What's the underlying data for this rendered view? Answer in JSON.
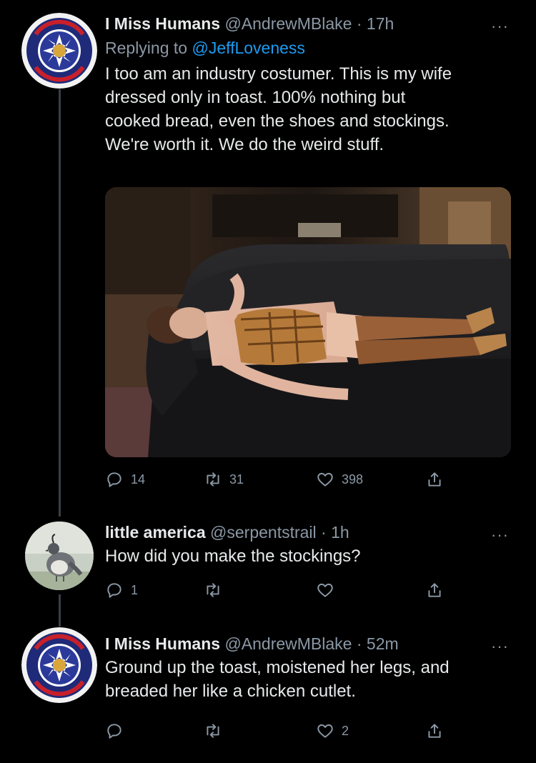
{
  "tweets": [
    {
      "name": "I Miss Humans",
      "handle": "@AndrewMBlake",
      "time": "17h",
      "replying_prefix": "Replying to",
      "replying_to": "@JeffLoveness",
      "text_lines": [
        "I too am an industry costumer. This is my wife",
        "dressed only in toast. 100% nothing but",
        "cooked bread, even the shoes and stockings.",
        "We're worth it. We do the weird stuff."
      ],
      "replies": "14",
      "retweets": "31",
      "likes": "398"
    },
    {
      "name": "little america",
      "handle": "@serpentstrail",
      "time": "1h",
      "text_lines": [
        "How did you make the stockings?"
      ],
      "replies": "1",
      "retweets": "",
      "likes": ""
    },
    {
      "name": "I Miss Humans",
      "handle": "@AndrewMBlake",
      "time": "52m",
      "text_lines": [
        "Ground up the toast, moistened her legs, and",
        "breaded her like a chicken cutlet."
      ],
      "replies": "",
      "retweets": "",
      "likes": "2"
    }
  ],
  "separator": "·",
  "more_glyph": "···",
  "logo_text": {
    "top": "VOTE",
    "bottom": "AUTHORIZATION"
  },
  "icons": {
    "reply": "reply-icon",
    "retweet": "retweet-icon",
    "like": "heart-icon",
    "share": "share-icon",
    "more": "more-options-icon"
  },
  "colors": {
    "background": "#000000",
    "text": "#e7e9ea",
    "muted": "#8b98a5",
    "link": "#1d9bf0"
  }
}
